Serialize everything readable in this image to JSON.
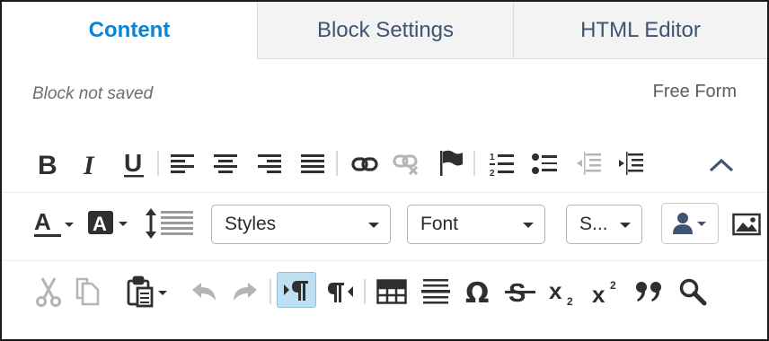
{
  "tabs": [
    {
      "label": "Content",
      "active": true
    },
    {
      "label": "Block Settings",
      "active": false
    },
    {
      "label": "HTML Editor",
      "active": false
    }
  ],
  "status_text": "Block not saved",
  "mode_label": "Free Form",
  "toolbar": {
    "styles_value": "Styles",
    "font_value": "Font",
    "size_value": "S..."
  },
  "colors": {
    "active_tab": "#0a84d6",
    "tab_text": "#3e5470",
    "icon": "#2f2f2f",
    "disabled_icon": "#b5b5b5",
    "pressed_bg": "#bfe0f2",
    "collapse_arrow": "#3e5470"
  },
  "icons": {
    "row1": [
      "bold-icon",
      "italic-icon",
      "underline-icon",
      "align-left-icon",
      "align-center-icon",
      "align-right-icon",
      "align-justify-icon",
      "link-icon",
      "unlink-icon",
      "anchor-flag-icon",
      "numbered-list-icon",
      "bulleted-list-icon",
      "outdent-icon",
      "indent-icon",
      "collapse-chevron-icon"
    ],
    "row2": [
      "text-color-icon",
      "background-color-icon",
      "line-height-icon",
      "user-icon",
      "image-icon"
    ],
    "row3": [
      "cut-icon",
      "copy-icon",
      "paste-icon",
      "undo-icon",
      "redo-icon",
      "ltr-direction-icon",
      "rtl-direction-icon",
      "table-icon",
      "horizontal-rule-icon",
      "special-char-omega-icon",
      "strikethrough-icon",
      "subscript-icon",
      "superscript-icon",
      "blockquote-icon",
      "find-icon"
    ]
  }
}
